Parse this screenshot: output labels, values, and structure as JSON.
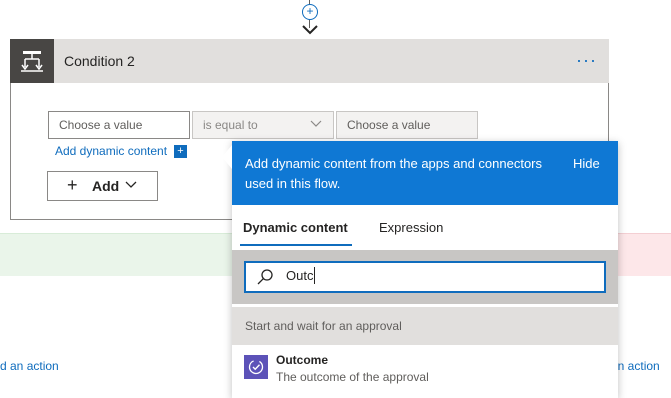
{
  "condition": {
    "title": "Condition 2",
    "more_label": "···",
    "left_placeholder": "Choose a value",
    "operator": "is equal to",
    "right_placeholder": "Choose a value",
    "add_dynamic_label": "Add dynamic content",
    "add_dynamic_badge": "+",
    "add_button_label": "Add"
  },
  "connector": {
    "plus": "+"
  },
  "branches": {
    "left_action_label": "d an action",
    "right_action_label": "an action"
  },
  "flyout": {
    "description": "Add dynamic content from the apps and connectors used in this flow.",
    "hide_label": "Hide",
    "tabs": [
      {
        "label": "Dynamic content",
        "active": true
      },
      {
        "label": "Expression",
        "active": false
      }
    ],
    "search": {
      "value": "Outc"
    },
    "section_title": "Start and wait for an approval",
    "items": [
      {
        "title": "Outcome",
        "description": "The outcome of the approval",
        "icon": "approval-icon"
      }
    ]
  },
  "colors": {
    "accent": "#0f6cbd",
    "flyout_header": "#0f78d4",
    "approval_icon_bg": "#5c52b8"
  }
}
